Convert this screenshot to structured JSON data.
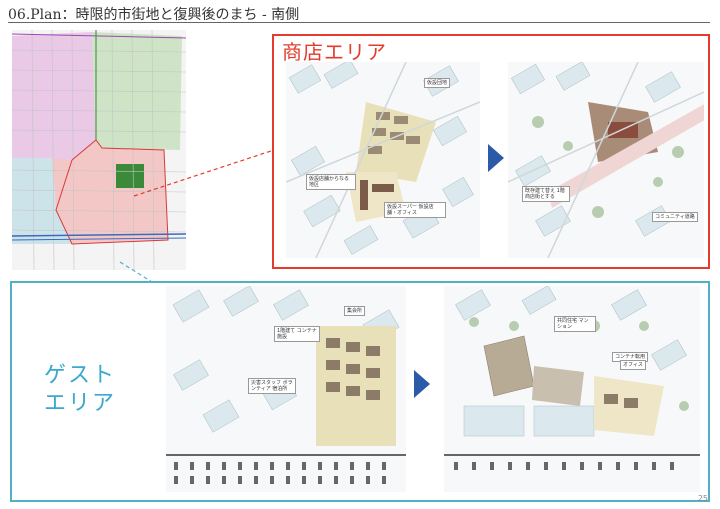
{
  "header": {
    "title": "06.Plan：時限的市街地と復興後のまち - 南側"
  },
  "sections": {
    "shop": {
      "label": "商店エリア",
      "color": "#e43b2c",
      "before_callouts": [
        "仮設団地",
        "仮設店舗からなる地区",
        "仮設スーパー 仮設店舗・オフィス"
      ],
      "after_callouts": [
        "既存建て替え 1階商店街とする",
        "コミュニティ道路"
      ]
    },
    "guest": {
      "label": "ゲスト\nエリア",
      "color": "#3aa9cd",
      "before_callouts": [
        "集会所",
        "1階建て コンテナ施設",
        "災害スタッフ ボランティア 宿泊所"
      ],
      "after_callouts": [
        "共同住宅 マンション",
        "コンテナ転用",
        "オフィス"
      ]
    }
  },
  "arrow_color": "#2b5aa6",
  "page_number": "25"
}
